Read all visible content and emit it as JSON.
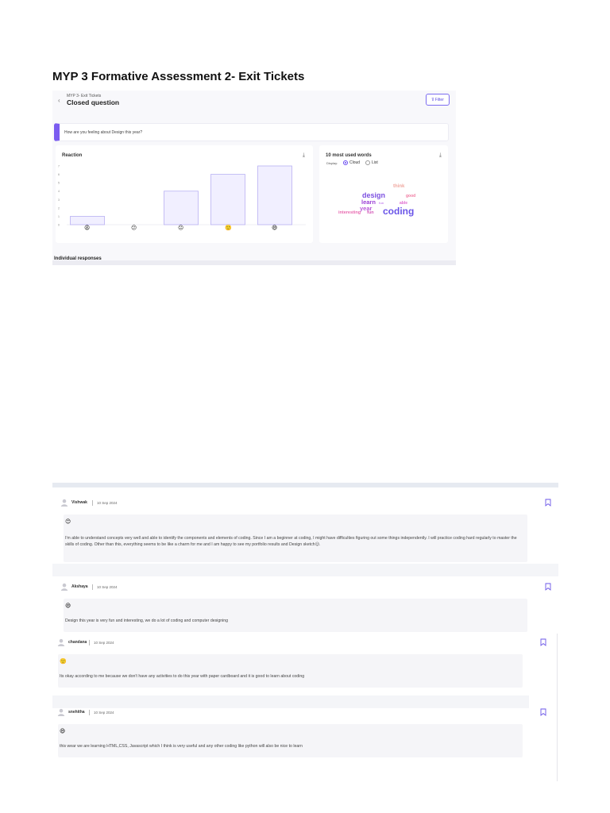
{
  "document": {
    "title": "MYP 3 Formative Assessment 2- Exit Tickets"
  },
  "header": {
    "breadcrumb": "MYP 3- Exit Tickets",
    "title": "Closed question",
    "filter_label": "Filter"
  },
  "question": {
    "text": "How are you feeling about Design this year?"
  },
  "reaction": {
    "title": "Reaction",
    "emojis": [
      "😩",
      "😕",
      "😐",
      "🙂",
      "😄"
    ]
  },
  "chart_data": {
    "type": "bar",
    "title": "Reaction",
    "categories": [
      "😩",
      "😕",
      "😐",
      "🙂",
      "😄"
    ],
    "values": [
      1,
      0,
      4,
      6,
      7
    ],
    "y_ticks": [
      "0",
      "1",
      "2",
      "3",
      "4",
      "5",
      "6",
      "7"
    ],
    "ylim": [
      0,
      7
    ],
    "grid": false,
    "bar_fill": "#f1efff",
    "bar_stroke": "#b9b1f3"
  },
  "words": {
    "title": "10 most used words",
    "display_label": "Display:",
    "option_cloud": "Cloud",
    "option_list": "List",
    "cloud": [
      {
        "text": "think",
        "color": "#f0a8a0"
      },
      {
        "text": "design",
        "color": "#7b4fe0"
      },
      {
        "text": "good",
        "color": "#f07aa0"
      },
      {
        "text": "learn",
        "color": "#9b3fd6"
      },
      {
        "text": "fun",
        "color": "#c98ef0"
      },
      {
        "text": "able",
        "color": "#e06ad0"
      },
      {
        "text": "year",
        "color": "#b85ad8"
      },
      {
        "text": "coding",
        "color": "#6a55e8"
      },
      {
        "text": "interesting",
        "color": "#e86ab0"
      },
      {
        "text": "fun",
        "color": "#d45ab8"
      }
    ]
  },
  "individual": {
    "title": "Individual responses"
  },
  "responses": [
    {
      "name": "Vishwak",
      "date": "10 Sep 2024",
      "emoji": "😊",
      "text": "I'm able to understand concepts very well and able to identify the components and elements of coding. Since I am a beginner at coding, I might have difficulties figuring out some things independently. I will practice coding hard regularly to master the skills of coding. Other than this, everything seems to be like a charm for me and I am happy to see my portfolio results and Design sketch😊."
    },
    {
      "name": "Akshaya",
      "date": "10 Sep 2024",
      "emoji": "😄",
      "text": "Design this year is very fun and interesting, we do a lot of coding and computer designing"
    },
    {
      "name": "chandana",
      "date": "10 Sep 2024",
      "emoji": "🙂",
      "text": "Its okay according to me because we don't have any activities to do this year with paper cardboard and it is good to learn about coding"
    },
    {
      "name": "snehitha",
      "date": "10 Sep 2024",
      "emoji": "😄",
      "text": "this wear we are learning HTML,CSS, Javascript which I think is very useful and any other coding like python will also be nice to learn"
    }
  ],
  "colors": {
    "accent": "#7b5cf0",
    "panel_bg": "#f8f8fb",
    "response_bg": "#f5f5f8"
  }
}
